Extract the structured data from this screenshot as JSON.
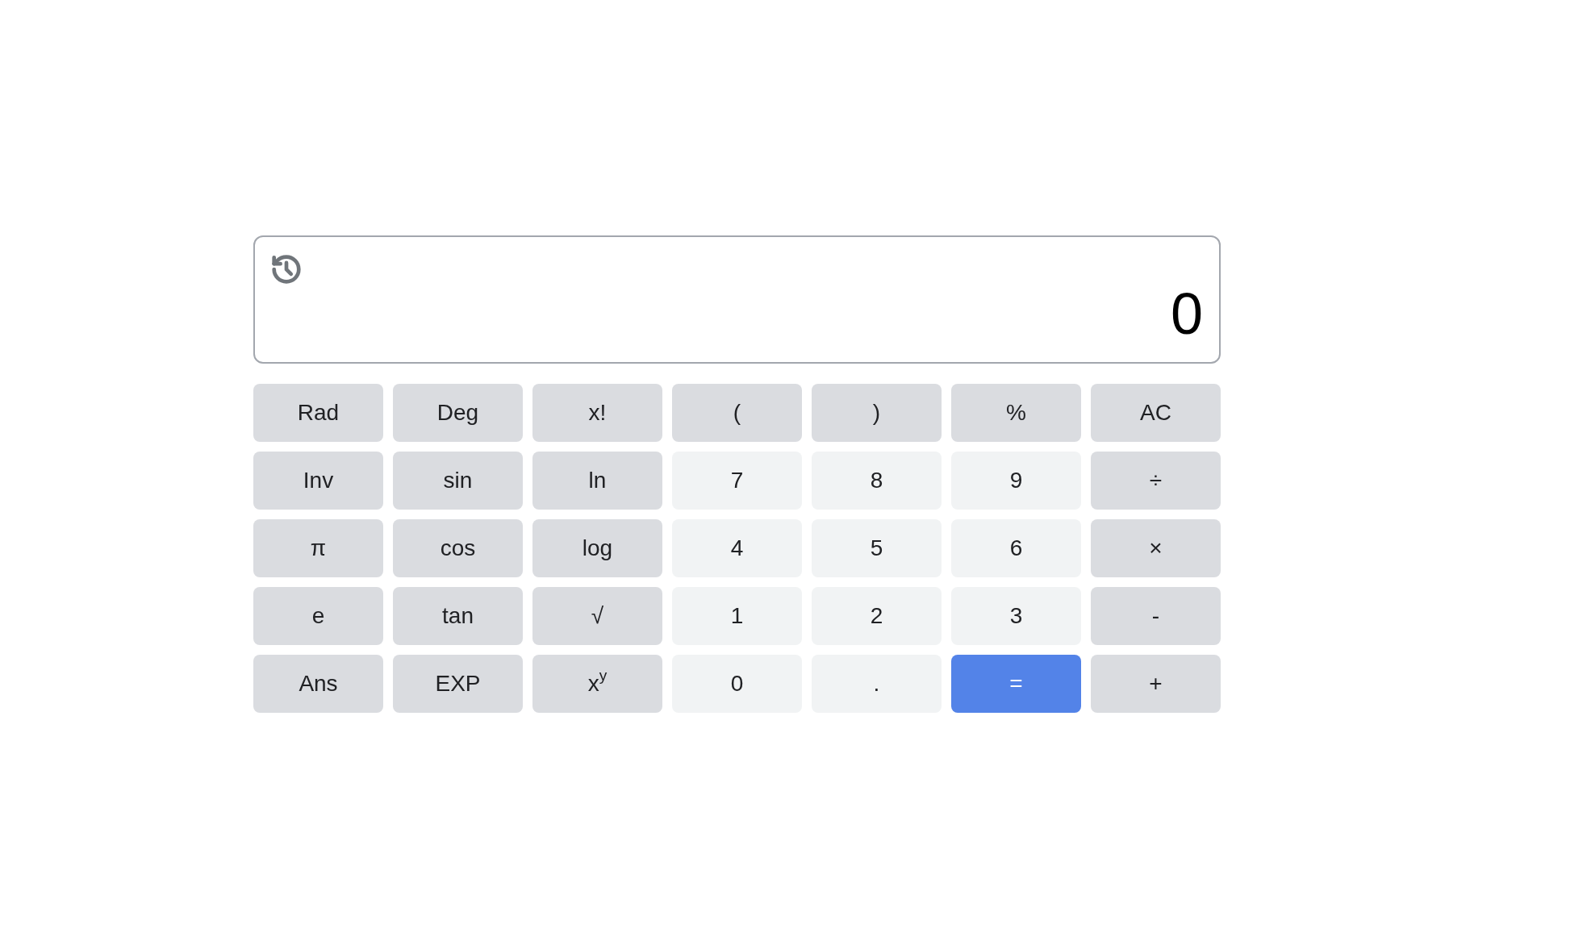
{
  "display": {
    "value": "0"
  },
  "keypad": {
    "rows": [
      [
        {
          "label": "Rad",
          "kind": "function"
        },
        {
          "label": "Deg",
          "kind": "function"
        },
        {
          "label": "x!",
          "kind": "function"
        },
        {
          "label": "(",
          "kind": "function"
        },
        {
          "label": ")",
          "kind": "function"
        },
        {
          "label": "%",
          "kind": "function"
        },
        {
          "label": "AC",
          "kind": "function"
        }
      ],
      [
        {
          "label": "Inv",
          "kind": "function"
        },
        {
          "label": "sin",
          "kind": "function"
        },
        {
          "label": "ln",
          "kind": "function"
        },
        {
          "label": "7",
          "kind": "digit"
        },
        {
          "label": "8",
          "kind": "digit"
        },
        {
          "label": "9",
          "kind": "digit"
        },
        {
          "label": "÷",
          "kind": "operator"
        }
      ],
      [
        {
          "label": "π",
          "kind": "function"
        },
        {
          "label": "cos",
          "kind": "function"
        },
        {
          "label": "log",
          "kind": "function"
        },
        {
          "label": "4",
          "kind": "digit"
        },
        {
          "label": "5",
          "kind": "digit"
        },
        {
          "label": "6",
          "kind": "digit"
        },
        {
          "label": "×",
          "kind": "operator"
        }
      ],
      [
        {
          "label": "e",
          "kind": "function"
        },
        {
          "label": "tan",
          "kind": "function"
        },
        {
          "label": "√",
          "kind": "function"
        },
        {
          "label": "1",
          "kind": "digit"
        },
        {
          "label": "2",
          "kind": "digit"
        },
        {
          "label": "3",
          "kind": "digit"
        },
        {
          "label": "-",
          "kind": "operator"
        }
      ],
      [
        {
          "label": "Ans",
          "kind": "function"
        },
        {
          "label": "EXP",
          "kind": "function"
        },
        {
          "label": "x$^{y}$",
          "kind": "function"
        },
        {
          "label": "0",
          "kind": "digit"
        },
        {
          "label": ".",
          "kind": "digit"
        },
        {
          "label": "=",
          "kind": "equals"
        },
        {
          "label": "+",
          "kind": "operator"
        }
      ]
    ]
  }
}
